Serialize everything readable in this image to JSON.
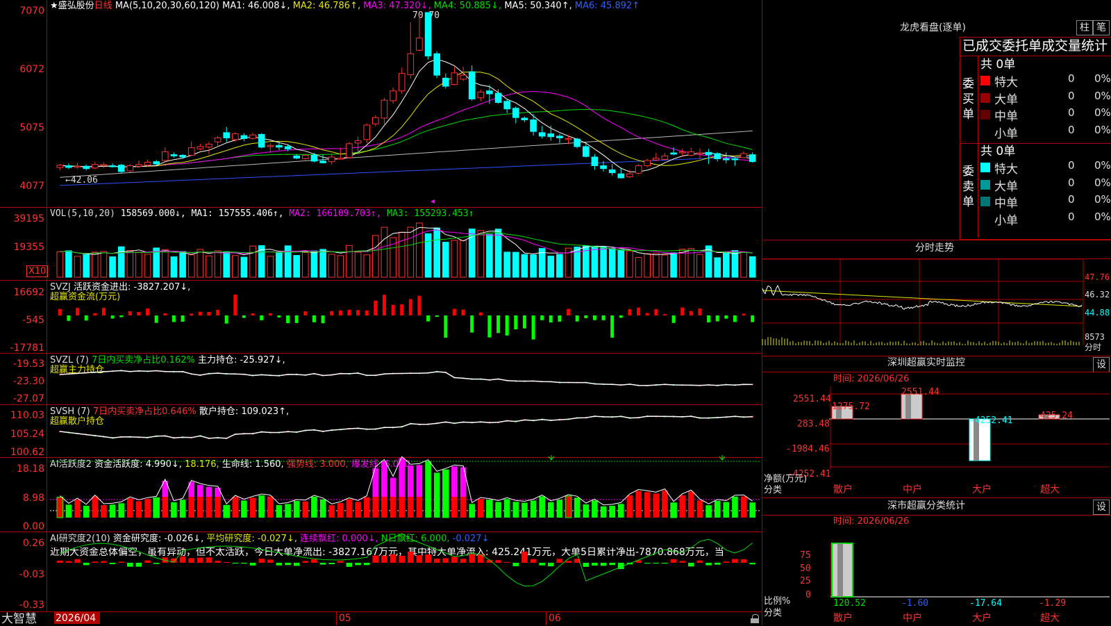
{
  "colors": {
    "up": "#ff3232",
    "down": "#00ffff",
    "grid": "#b00000",
    "green": "#00dd00",
    "magenta": "#ff00ff",
    "yellow": "#e6e600",
    "white": "#ffffff"
  },
  "main": {
    "star_icon": "★",
    "stock_name": "盛弘股份",
    "period": "日线",
    "ma_param": "MA(5,10,20,30,60,120)",
    "ma": [
      {
        "label": "MA1: 46.008↓,",
        "color": "#ffffff"
      },
      {
        "label": "MA2: 46.786↑,",
        "color": "#e6e600"
      },
      {
        "label": "MA3: 47.320↓,",
        "color": "#ff00ff"
      },
      {
        "label": "MA4: 50.885↓,",
        "color": "#00dd00"
      },
      {
        "label": "MA5: 50.340↑,",
        "color": "#ffffff"
      },
      {
        "label": "MA6: 45.892↑",
        "color": "#3060ff"
      }
    ],
    "yaxis": [
      "7070",
      "6072",
      "5075",
      "4077"
    ],
    "high_note": "70.70",
    "low_note": "←42.06"
  },
  "vol": {
    "name": "VOL(5,10,20)",
    "value": "158569.000↓,",
    "ma1": "MA1: 157555.406↑,",
    "ma2": "MA2: 166109.703↑,",
    "ma3": "MA3: 155293.453↑",
    "yaxis": [
      "39195",
      "19355"
    ],
    "unit": "X10"
  },
  "svzj": {
    "line1a": "SVZJ",
    "line1b": "活跃资金进出: -3827.207↓,",
    "line2": "超赢资金流(万元)",
    "yaxis": [
      "16692",
      "-545",
      "-17781"
    ]
  },
  "svzl": {
    "line1a": "SVZL (7)",
    "line1b": "7日内买卖净占比0.162%",
    "line1c": "主力持仓: -25.927↓,",
    "line2": "超赢主力持仓",
    "yaxis": [
      "-19.53",
      "-23.30",
      "-27.07"
    ]
  },
  "svsh": {
    "line1a": "SVSH (7)",
    "line1b": "7日内买卖净占比0.646%",
    "line1c": "散户持仓: 109.023↑,",
    "line2": "超赢散户持仓",
    "yaxis": [
      "110.03",
      "105.24",
      "100.62"
    ]
  },
  "ai1": {
    "a": "AI活跃度2",
    "b": "资金活跃度: 4.990↓,",
    "c": "18.176,",
    "d": "生命线: 1.560,",
    "e": "强势线: 3.000,",
    "f": "爆发线: 6.000,",
    "yaxis": [
      "18.18",
      "8.98",
      "0.00"
    ]
  },
  "ai2": {
    "a": "AI研究度2(10)",
    "b": "资金研究度: -0.026↓,",
    "c": "平均研究度: -0.027↓,",
    "d": "连续飘红: 0.000↓,",
    "e": "N日飘红: 6.000,",
    "f": "-0.027↓",
    "commentary": "近期大资金总体偏空，虽有异动，但不太活跃，今日大单净流出: -3827.167万元，其中特大单净流入: 425.241万元，大单5日累计净出-7870.868万元，当",
    "yaxis": [
      "0.26",
      "-0.03",
      "-0.33"
    ]
  },
  "bottom": {
    "brand": "大智慧",
    "dates": [
      "2026/04",
      "05",
      "06"
    ]
  },
  "right": {
    "longhu_title": "龙虎看盘(逐单)",
    "btn_zhu": "柱",
    "btn_bi": "笔",
    "header": "已成交委托单成交量统计",
    "buy_group": "委买单",
    "sell_group": "委卖单",
    "buy_total": "共 0单",
    "sell_total": "共 0单",
    "buy_rows": [
      {
        "label": "特大",
        "val": "0",
        "pct": "0%",
        "color": "#ff0000"
      },
      {
        "label": "大单",
        "val": "0",
        "pct": "0%",
        "color": "#990000"
      },
      {
        "label": "中单",
        "val": "0",
        "pct": "0%",
        "color": "#660000"
      },
      {
        "label": "小单",
        "val": "0",
        "pct": "0%",
        "color": "#000000"
      }
    ],
    "sell_rows": [
      {
        "label": "特大",
        "val": "0",
        "pct": "0%",
        "color": "#00ffff"
      },
      {
        "label": "大单",
        "val": "0",
        "pct": "0%",
        "color": "#009999"
      },
      {
        "label": "中单",
        "val": "0",
        "pct": "0%",
        "color": "#007777"
      },
      {
        "label": "小单",
        "val": "0",
        "pct": "0%",
        "color": "#000000"
      }
    ],
    "fenshi_title": "分时走势",
    "fenshi_y": [
      "47.76",
      "46.32",
      "44.88",
      "8573",
      "分时"
    ],
    "monitor_title": "深圳超赢实时监控",
    "monitor_set": "设",
    "monitor_time": "时间: 2026/06/26",
    "monitor_y": [
      "2551.44",
      "283.48",
      "-1984.46",
      "-4252.41"
    ],
    "monitor_bar_labels": [
      "1275.72",
      "2551.44",
      "-4252.41",
      "425.24"
    ],
    "monitor_cats": [
      "散户",
      "中户",
      "大户",
      "超大"
    ],
    "monitor_ylabel1": "净额(万元)",
    "monitor_ylabel2": "分类",
    "stat_title": "深市超赢分类统计",
    "stat_set": "设",
    "stat_time": "时间: 2026/06/26",
    "stat_y": [
      "75",
      "50",
      "25",
      "0"
    ],
    "stat_vals": [
      "120.52",
      "-1.60",
      "-17.64",
      "-1.29"
    ],
    "stat_cats": [
      "散户",
      "中户",
      "大户",
      "超大"
    ],
    "stat_ylabel1": "比例%",
    "stat_ylabel2": "分类"
  },
  "chart_data": [
    {
      "type": "candlestick",
      "title": "盛弘股份 日线",
      "ylim": [
        40.77,
        70.7
      ],
      "candles": [
        [
          44.0,
          44.4,
          44.6,
          43.5
        ],
        [
          44.3,
          44.0,
          44.7,
          43.7
        ],
        [
          44.1,
          44.2,
          44.8,
          43.8
        ],
        [
          44.2,
          43.8,
          44.5,
          43.5
        ],
        [
          43.9,
          44.5,
          45.0,
          43.7
        ],
        [
          44.4,
          44.5,
          44.9,
          43.9
        ],
        [
          44.3,
          44.2,
          44.7,
          44.0
        ],
        [
          44.4,
          43.3,
          44.6,
          43.0
        ],
        [
          43.4,
          44.3,
          44.6,
          43.2
        ],
        [
          44.2,
          44.5,
          45.2,
          43.9
        ],
        [
          44.4,
          44.9,
          45.3,
          44.2
        ],
        [
          45.0,
          44.6,
          45.3,
          44.3
        ],
        [
          45.2,
          46.7,
          47.5,
          44.8
        ],
        [
          46.2,
          46.0,
          46.6,
          45.7
        ],
        [
          46.1,
          45.8,
          46.3,
          45.5
        ],
        [
          46.1,
          47.4,
          48.5,
          45.9
        ],
        [
          47.2,
          47.6,
          48.1,
          46.9
        ],
        [
          47.5,
          48.0,
          48.4,
          46.3
        ],
        [
          48.4,
          49.1,
          49.4,
          47.5
        ],
        [
          50.0,
          49.1,
          51.0,
          48.4
        ],
        [
          48.8,
          49.8,
          50.1,
          48.4
        ],
        [
          49.5,
          49.0,
          49.9,
          48.5
        ],
        [
          49.0,
          49.6,
          50.0,
          48.8
        ],
        [
          49.7,
          47.5,
          49.9,
          47.3
        ],
        [
          47.6,
          47.8,
          48.2,
          46.5
        ],
        [
          47.8,
          47.5,
          48.5,
          47.0
        ],
        [
          47.6,
          47.2,
          47.9,
          46.8
        ],
        [
          46.0,
          45.6,
          46.3,
          45.4
        ],
        [
          45.5,
          46.1,
          46.3,
          45.3
        ],
        [
          46.1,
          45.1,
          46.5,
          44.9
        ],
        [
          45.1,
          44.8,
          46.3,
          44.7
        ],
        [
          45.0,
          45.8,
          46.4,
          44.5
        ],
        [
          45.6,
          45.6,
          47.4,
          45.4
        ],
        [
          45.7,
          48.1,
          48.4,
          45.6
        ],
        [
          48.2,
          48.6,
          49.3,
          46.5
        ],
        [
          48.8,
          51.3,
          51.6,
          48.2
        ],
        [
          51.5,
          52.6,
          53.0,
          51.1
        ],
        [
          52.5,
          55.6,
          56.0,
          51.5
        ],
        [
          55.5,
          57.2,
          57.8,
          55.0
        ],
        [
          57.2,
          60.2,
          61.2,
          56.7
        ],
        [
          60.0,
          63.6,
          69.0,
          59.3
        ],
        [
          64.2,
          66.3,
          70.5,
          64.0
        ],
        [
          70.7,
          63.2,
          70.7,
          62.6
        ],
        [
          63.6,
          59.9,
          64.0,
          59.4
        ],
        [
          59.4,
          58.0,
          60.2,
          57.6
        ],
        [
          58.3,
          60.3,
          61.3,
          58.1
        ],
        [
          59.2,
          59.9,
          61.4,
          58.9
        ],
        [
          60.5,
          55.8,
          61.6,
          55.5
        ],
        [
          56.0,
          57.0,
          57.4,
          55.4
        ],
        [
          57.2,
          56.7,
          58.2,
          55.0
        ],
        [
          56.8,
          55.2,
          57.5,
          55.0
        ],
        [
          55.4,
          54.1,
          55.8,
          53.4
        ],
        [
          54.2,
          52.6,
          54.5,
          51.6
        ],
        [
          52.5,
          52.2,
          52.8,
          51.8
        ],
        [
          52.2,
          50.2,
          53.2,
          49.5
        ],
        [
          50.0,
          49.4,
          51.1,
          49.0
        ],
        [
          49.8,
          49.3,
          51.2,
          48.6
        ],
        [
          49.4,
          49.1,
          49.8,
          48.2
        ],
        [
          48.9,
          49.0,
          49.5,
          48.0
        ],
        [
          48.9,
          47.6,
          49.1,
          47.3
        ],
        [
          47.6,
          45.9,
          48.3,
          45.7
        ],
        [
          45.8,
          44.3,
          46.3,
          43.6
        ],
        [
          44.3,
          43.8,
          45.1,
          43.3
        ],
        [
          43.6,
          43.1,
          44.6,
          42.6
        ],
        [
          42.9,
          42.2,
          43.8,
          42.1
        ],
        [
          42.4,
          42.9,
          43.6,
          42.2
        ],
        [
          43.0,
          44.3,
          44.6,
          42.8
        ],
        [
          44.3,
          45.2,
          45.5,
          44.0
        ],
        [
          45.3,
          45.6,
          46.5,
          45.1
        ],
        [
          45.4,
          46.0,
          46.5,
          45.2
        ],
        [
          46.5,
          46.3,
          47.5,
          46.1
        ],
        [
          46.6,
          46.7,
          47.2,
          45.9
        ],
        [
          46.1,
          46.7,
          47.4,
          45.9
        ],
        [
          46.5,
          46.5,
          47.3,
          45.5
        ],
        [
          46.6,
          46.2,
          47.2,
          44.6
        ],
        [
          46.4,
          45.5,
          46.6,
          45.0
        ],
        [
          45.5,
          45.4,
          46.6,
          44.7
        ],
        [
          45.5,
          45.4,
          45.7,
          44.3
        ],
        [
          45.7,
          46.4,
          46.8,
          45.6
        ],
        [
          46.2,
          45.0,
          46.6,
          44.8
        ]
      ]
    },
    {
      "type": "bar",
      "title": "SVZJ 超赢资金流(万元)",
      "ylim": [
        -17781,
        16692
      ]
    },
    {
      "type": "bar",
      "title": "深圳超赢实时监控",
      "categories": [
        "散户",
        "中户",
        "大户",
        "超大"
      ],
      "values": [
        1275.72,
        2551.44,
        -4252.41,
        425.24
      ],
      "ylim": [
        -4252.41,
        2551.44
      ]
    },
    {
      "type": "bar",
      "title": "深市超赢分类统计",
      "categories": [
        "散户",
        "中户",
        "大户",
        "超大"
      ],
      "values": [
        120.52,
        -1.6,
        -17.64,
        -1.29
      ]
    }
  ]
}
